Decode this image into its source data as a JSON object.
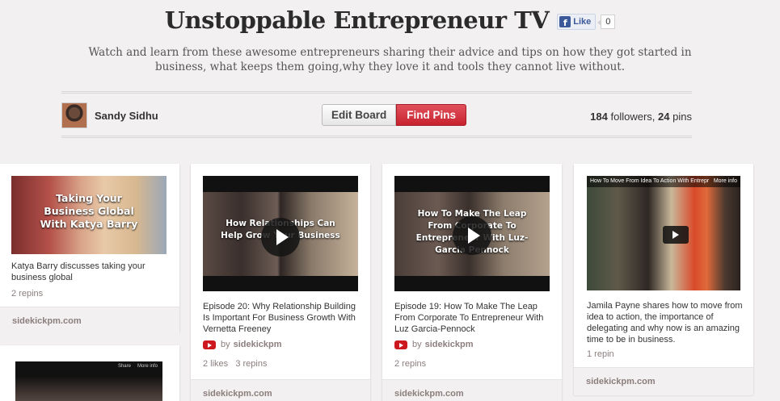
{
  "board": {
    "title": "Unstoppable Entrepreneur TV",
    "description": "Watch and learn from these awesome entrepreneurs sharing their advice and tips on how they got started in business, what keeps them going,why they love it and tools they cannot live without."
  },
  "facebook": {
    "like_label": "Like",
    "like_count": "0",
    "brand_color": "#3b5998"
  },
  "owner": {
    "name": "Sandy Sidhu"
  },
  "actions": {
    "edit_label": "Edit Board",
    "find_label": "Find Pins",
    "find_color": "#cb2027"
  },
  "stats": {
    "followers_count": "184",
    "followers_label": "followers,",
    "pins_count": "24",
    "pins_label": "pins"
  },
  "pins": [
    {
      "overlay": "Taking Your Business Global With Katya Barry",
      "description": "Katya Barry discusses taking your business global",
      "stats": "2 repins",
      "footer": "sidekickpm.com"
    },
    {
      "overlay": "How Relationships Can Help Grow Your Business",
      "description": "Episode 20: Why Relationship Building Is Important For Business Growth With Vernetta Freeney",
      "via_prefix": "by",
      "via_name": "sidekickpm",
      "stats": "2 likes   3 repins",
      "footer": "sidekickpm.com"
    },
    {
      "overlay": "How To Make The Leap From Corporate To Entrepreneur With Luz-Garcia Pennock",
      "description": "Episode 19: How To Make The Leap From Corporate To Entrepreneur With Luz Garcia-Pennock",
      "via_prefix": "by",
      "via_name": "sidekickpm",
      "stats": "2 repins",
      "footer": "sidekickpm.com"
    },
    {
      "video_title": "How To Move From Idea To Action With Entrepr",
      "video_more": "More info",
      "description": "Jamila Payne shares how to move from idea to action, the importance of delegating and why now is an amazing time to be in business.",
      "stats": "1 repin",
      "footer": "sidekickpm.com"
    },
    {
      "video_share": "Share",
      "video_more": "More info"
    }
  ]
}
